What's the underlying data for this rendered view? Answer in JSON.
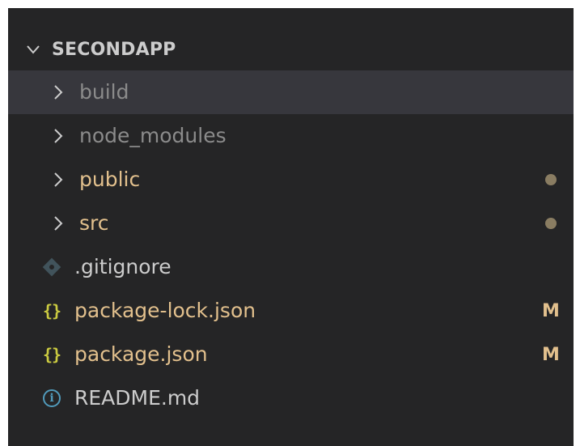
{
  "explorer": {
    "folder_name": "SECONDAPP",
    "items": [
      {
        "label": "build",
        "kind": "folder",
        "icon": "chevron-right-icon",
        "color": "#8b8b8b",
        "selected": true,
        "decoration": ""
      },
      {
        "label": "node_modules",
        "kind": "folder",
        "icon": "chevron-right-icon",
        "color": "#8b8b8b",
        "selected": false,
        "decoration": ""
      },
      {
        "label": "public",
        "kind": "folder",
        "icon": "chevron-right-icon",
        "color": "#e2c08d",
        "selected": false,
        "decoration": "dot"
      },
      {
        "label": "src",
        "kind": "folder",
        "icon": "chevron-right-icon",
        "color": "#e2c08d",
        "selected": false,
        "decoration": "dot"
      },
      {
        "label": ".gitignore",
        "kind": "file",
        "icon": "git-file-icon",
        "color": "#cccccc",
        "selected": false,
        "decoration": ""
      },
      {
        "label": "package-lock.json",
        "kind": "file",
        "icon": "json-braces-icon",
        "color": "#e2c08d",
        "selected": false,
        "decoration": "M"
      },
      {
        "label": "package.json",
        "kind": "file",
        "icon": "json-braces-icon",
        "color": "#e2c08d",
        "selected": false,
        "decoration": "M"
      },
      {
        "label": "README.md",
        "kind": "file",
        "icon": "info-icon",
        "color": "#cccccc",
        "selected": false,
        "decoration": ""
      }
    ]
  },
  "colors": {
    "background": "#252526",
    "selection": "#37373d",
    "modified": "#e2c08d",
    "ignored": "#8b8b8b"
  }
}
